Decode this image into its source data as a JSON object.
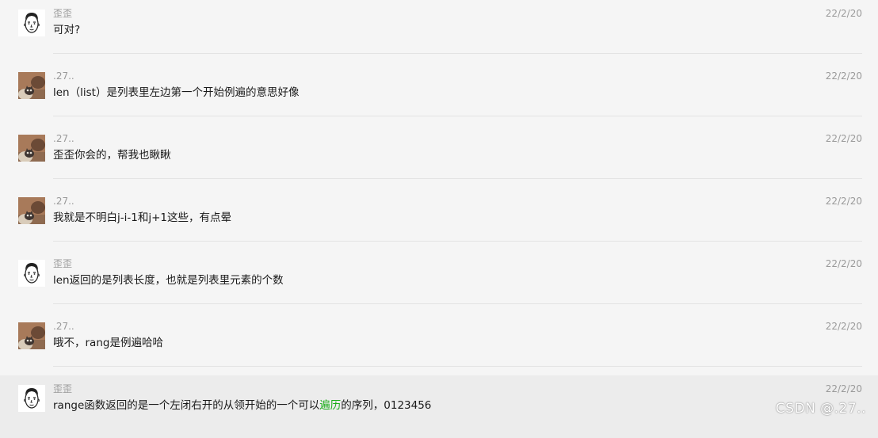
{
  "messages": [
    {
      "sender": "歪歪",
      "avatar": "face-avatar",
      "time": "22/2/20",
      "text": "可对?"
    },
    {
      "sender": ".27..",
      "avatar": "cat-avatar",
      "time": "22/2/20",
      "text": "len（list）是列表里左边第一个开始例遍的意思好像"
    },
    {
      "sender": ".27..",
      "avatar": "cat-avatar",
      "time": "22/2/20",
      "text": "歪歪你会的，帮我也瞅瞅"
    },
    {
      "sender": ".27..",
      "avatar": "cat-avatar",
      "time": "22/2/20",
      "text": "我就是不明白j-i-1和j+1这些，有点晕"
    },
    {
      "sender": "歪歪",
      "avatar": "face-avatar",
      "time": "22/2/20",
      "text": "len返回的是列表长度，也就是列表里元素的个数"
    },
    {
      "sender": ".27..",
      "avatar": "cat-avatar",
      "time": "22/2/20",
      "text": "哦不，rang是例遍哈哈"
    },
    {
      "sender": "歪歪",
      "avatar": "face-avatar",
      "time": "22/2/20",
      "text_before": "range函数返回的是一个左闭右开的从领开始的一个可以",
      "link_text": "遍历",
      "text_after": "的序列，0123456",
      "link_color": "#1aad19"
    }
  ],
  "watermark": "CSDN @.27.."
}
